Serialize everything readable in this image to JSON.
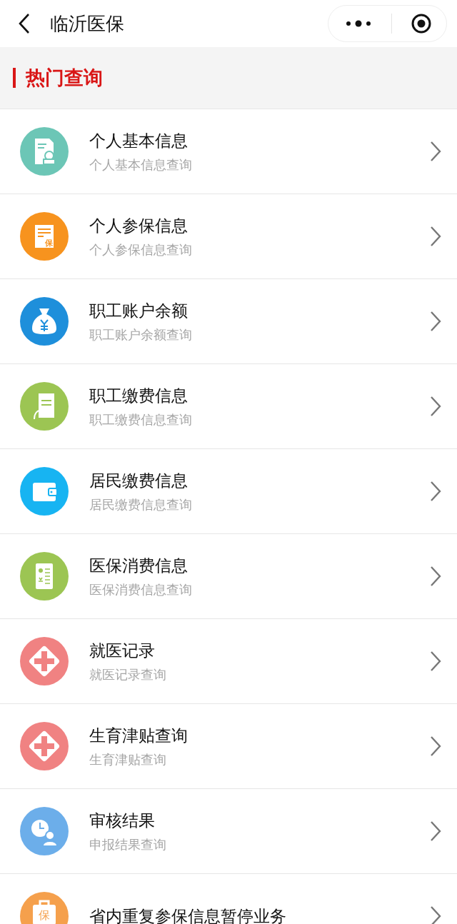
{
  "nav_bar": {
    "title": "临沂医保"
  },
  "section": {
    "title": "热门查询"
  },
  "items": [
    {
      "title": "个人基本信息",
      "subtitle": "个人基本信息查询",
      "kind": "profile",
      "color": "#6cc6b6"
    },
    {
      "title": "个人参保信息",
      "subtitle": "个人参保信息查询",
      "kind": "certificate",
      "color": "#f7931e",
      "icon_text": "保"
    },
    {
      "title": "职工账户余额",
      "subtitle": "职工账户余额查询",
      "kind": "moneybag",
      "color": "#1e8fdb"
    },
    {
      "title": "职工缴费信息",
      "subtitle": "职工缴费信息查询",
      "kind": "handdoc",
      "color": "#9cc553"
    },
    {
      "title": "居民缴费信息",
      "subtitle": "居民缴费信息查询",
      "kind": "wallet",
      "color": "#17b4f2"
    },
    {
      "title": "医保消费信息",
      "subtitle": "医保消费信息查询",
      "kind": "receipt",
      "color": "#9cc553"
    },
    {
      "title": "就医记录",
      "subtitle": "就医记录查询",
      "kind": "medical",
      "color": "#f08282"
    },
    {
      "title": "生育津贴查询",
      "subtitle": "生育津贴查询",
      "kind": "medical",
      "color": "#f08282"
    },
    {
      "title": "审核结果",
      "subtitle": "申报结果查询",
      "kind": "clock",
      "color": "#6caeea"
    },
    {
      "title": "省内重复参保信息暂停业务",
      "kind": "case",
      "color": "#f5a04c",
      "icon_text": "保"
    }
  ]
}
